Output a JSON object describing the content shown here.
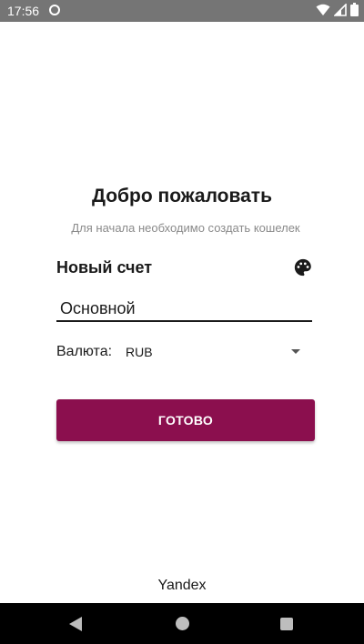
{
  "status_bar": {
    "time": "17:56",
    "app_icon": "notification-icon",
    "icons": [
      "wifi-icon",
      "signal-icon",
      "battery-icon"
    ]
  },
  "welcome": {
    "title": "Добро пожаловать",
    "subtitle": "Для начала необходимо создать кошелек"
  },
  "account": {
    "heading": "Новый счет",
    "color_picker_icon": "palette-icon",
    "name_value": "Основной"
  },
  "currency": {
    "label": "Валюта:",
    "selected": "RUB"
  },
  "done_button": {
    "label": "ГОТОВО"
  },
  "footer": {
    "brand": "Yandex"
  },
  "nav_bar": {
    "icons": [
      "back-icon",
      "home-icon",
      "recents-icon"
    ]
  },
  "colors": {
    "accent": "#8b0f4e",
    "status_bar": "#757575",
    "nav_bar": "#000000"
  }
}
